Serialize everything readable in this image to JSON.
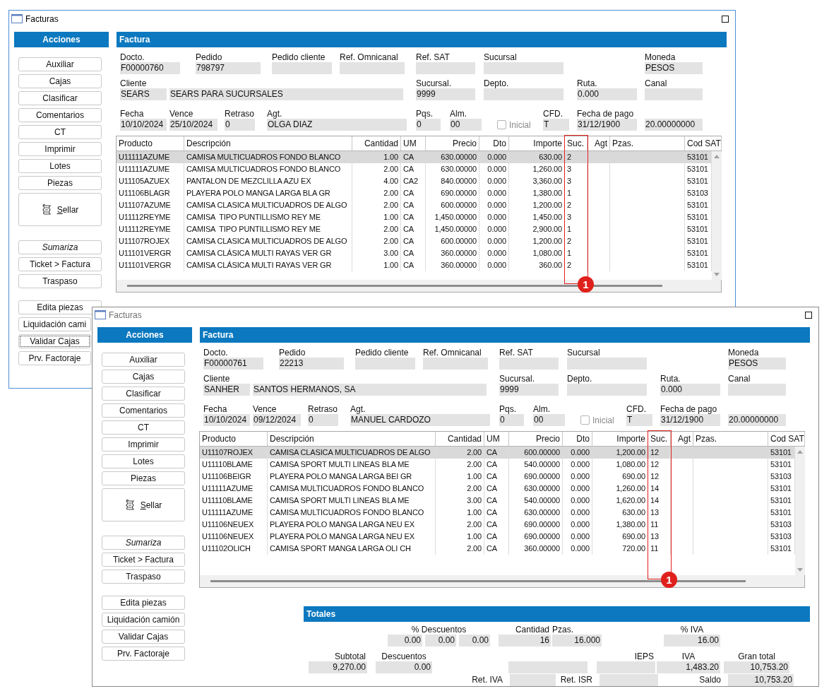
{
  "windows": [
    {
      "title": "Facturas",
      "active": true,
      "sidebar": {
        "title": "Acciones",
        "groups": [
          [
            {
              "kind": "plain",
              "label": "Auxiliar",
              "focused": false
            },
            {
              "kind": "plain",
              "label": "Cajas",
              "focused": false
            },
            {
              "kind": "plain",
              "label": "Clasificar",
              "focused": false
            },
            {
              "kind": "plain",
              "label": "Comentarios",
              "focused": false
            },
            {
              "kind": "plain",
              "label": "CT",
              "focused": false
            },
            {
              "kind": "plain",
              "label": "Imprimir",
              "focused": false
            },
            {
              "kind": "plain",
              "label": "Lotes",
              "focused": false
            },
            {
              "kind": "plain",
              "label": "Piezas",
              "focused": false
            },
            {
              "kind": "icon",
              "label": "Sellar",
              "focused": false
            }
          ],
          [
            {
              "kind": "mode",
              "label": "Sumariza",
              "focused": false
            },
            {
              "kind": "plain",
              "label": "Ticket > Factura",
              "focused": false
            },
            {
              "kind": "plain",
              "label": "Traspaso",
              "focused": false
            }
          ],
          [
            {
              "kind": "plain",
              "label": "Edita piezas",
              "focused": false
            },
            {
              "kind": "clipped",
              "label": "Liquidación cami",
              "focused": false
            },
            {
              "kind": "clipped",
              "label": "Validar Cajas",
              "focused": true
            },
            {
              "kind": "clipped",
              "label": "Prv. Factoraje",
              "focused": false
            }
          ]
        ]
      },
      "panel_title": "Factura",
      "form": {
        "fields": [
          {
            "kind": "text",
            "label": "Docto.",
            "value": "F00000760"
          },
          {
            "kind": "text",
            "label": "Pedido",
            "value": "798797"
          },
          {
            "kind": "text",
            "label": "Pedido cliente"
          },
          {
            "kind": "text",
            "label": "Ref. Omnicanal"
          },
          {
            "kind": "text",
            "label": "Ref. SAT"
          },
          {
            "kind": "text",
            "label": "Sucursal"
          },
          {
            "kind": "text",
            "label": "Moneda",
            "value": "PESOS"
          },
          {
            "kind": "text",
            "label": "Cliente",
            "value": "SEARS"
          },
          {
            "kind": "text",
            "value": "SEARS PARA SUCURSALES"
          },
          {
            "kind": "text",
            "label": "Sucursal.",
            "value": "9999"
          },
          {
            "kind": "text",
            "label": "Depto."
          },
          {
            "kind": "text",
            "label": "Ruta.",
            "value": "0.000"
          },
          {
            "kind": "text",
            "label": "Canal"
          },
          {
            "kind": "text",
            "label": "Fecha",
            "value": "10/10/2024"
          },
          {
            "kind": "text",
            "label": "Vence",
            "value": "25/10/2024"
          },
          {
            "kind": "text",
            "label": "Retraso",
            "value": "0"
          },
          {
            "kind": "text",
            "label": "Agt.",
            "value": "OLGA DIAZ"
          },
          {
            "kind": "text",
            "label": "Pqs.",
            "value": "0"
          },
          {
            "kind": "text",
            "label": "Alm.",
            "value": "00"
          },
          {
            "kind": "checkbox",
            "label": "Inicial",
            "checked": false,
            "disabled": true
          },
          {
            "kind": "text",
            "label": "CFD.",
            "value": "T"
          },
          {
            "kind": "text",
            "label": "Fecha de pago",
            "value": "31/12/1900"
          },
          {
            "kind": "text",
            "value": "20.00000000"
          }
        ]
      },
      "table": {
        "columns": [
          "Producto",
          "Descripción",
          "Cantidad",
          "UM",
          "Precio",
          "Dto",
          "Importe",
          "Suc.",
          "Agt",
          "Pzas.",
          "Cod SAT"
        ],
        "annotation": {
          "badge": "1"
        },
        "rows": [
          {
            "selected": true,
            "producto": "U11111AZUME",
            "descripcion": "CAMISA MULTICUADROS FONDO BLANCO",
            "cantidad": "1.00",
            "um": "CA",
            "precio": "630.00000",
            "dto": "0.000",
            "importe": "630.00",
            "suc": "2",
            "cod_sat": "53101"
          },
          {
            "selected": false,
            "producto": "U11111AZUME",
            "descripcion": "CAMISA MULTICUADROS FONDO BLANCO",
            "cantidad": "2.00",
            "um": "CA",
            "precio": "630.00000",
            "dto": "0.000",
            "importe": "1,260.00",
            "suc": "3",
            "cod_sat": "53101"
          },
          {
            "selected": false,
            "producto": "U11105AZUEX",
            "descripcion": "PANTALON DE MEZCLILLA AZU EX",
            "cantidad": "4.00",
            "um": "CA2",
            "precio": "840.00000",
            "dto": "0.000",
            "importe": "3,360.00",
            "suc": "3",
            "cod_sat": "53101"
          },
          {
            "selected": false,
            "producto": "U11106BLAGR",
            "descripcion": "PLAYERA POLO MANGA LARGA BLA GR",
            "cantidad": "2.00",
            "um": "CA",
            "precio": "690.00000",
            "dto": "0.000",
            "importe": "1,380.00",
            "suc": "1",
            "cod_sat": "53103"
          },
          {
            "selected": false,
            "producto": "U11107AZUME",
            "descripcion": "CAMISA CLASICA MULTICUADROS DE ALGO",
            "cantidad": "2.00",
            "um": "CA",
            "precio": "600.00000",
            "dto": "0.000",
            "importe": "1,200.00",
            "suc": "2",
            "cod_sat": "53101"
          },
          {
            "selected": false,
            "producto": "U11112REYME",
            "descripcion": "CAMISA  TIPO PUNTILLISMO REY ME",
            "cantidad": "1.00",
            "um": "CA",
            "precio": "1,450.00000",
            "dto": "0.000",
            "importe": "1,450.00",
            "suc": "3",
            "cod_sat": "53101"
          },
          {
            "selected": false,
            "producto": "U11112REYME",
            "descripcion": "CAMISA  TIPO PUNTILLISMO REY ME",
            "cantidad": "2.00",
            "um": "CA",
            "precio": "1,450.00000",
            "dto": "0.000",
            "importe": "2,900.00",
            "suc": "1",
            "cod_sat": "53101"
          },
          {
            "selected": false,
            "producto": "U11107ROJEX",
            "descripcion": "CAMISA CLASICA MULTICUADROS DE ALGO",
            "cantidad": "2.00",
            "um": "CA",
            "precio": "600.00000",
            "dto": "0.000",
            "importe": "1,200.00",
            "suc": "2",
            "cod_sat": "53101"
          },
          {
            "selected": false,
            "producto": "U11101VERGR",
            "descripcion": "CAMISA CLÁSICA MULTI RAYAS VER GR",
            "cantidad": "3.00",
            "um": "CA",
            "precio": "360.00000",
            "dto": "0.000",
            "importe": "1,080.00",
            "suc": "1",
            "cod_sat": "53101"
          },
          {
            "selected": false,
            "producto": "U11101VERGR",
            "descripcion": "CAMISA CLÁSICA MULTI RAYAS VER GR",
            "cantidad": "1.00",
            "um": "CA",
            "precio": "360.00000",
            "dto": "0.000",
            "importe": "360.00",
            "suc": "2",
            "cod_sat": "53101"
          }
        ]
      }
    },
    {
      "title": "Facturas",
      "active": false,
      "sidebar": {
        "title": "Acciones",
        "groups": [
          [
            {
              "kind": "plain",
              "label": "Auxiliar",
              "focused": false
            },
            {
              "kind": "plain",
              "label": "Cajas",
              "focused": false
            },
            {
              "kind": "plain",
              "label": "Clasificar",
              "focused": false
            },
            {
              "kind": "plain",
              "label": "Comentarios",
              "focused": false
            },
            {
              "kind": "plain",
              "label": "CT",
              "focused": false
            },
            {
              "kind": "plain",
              "label": "Imprimir",
              "focused": false
            },
            {
              "kind": "plain",
              "label": "Lotes",
              "focused": false
            },
            {
              "kind": "plain",
              "label": "Piezas",
              "focused": false
            },
            {
              "kind": "icon",
              "label": "Sellar",
              "focused": false
            }
          ],
          [
            {
              "kind": "mode",
              "label": "Sumariza",
              "focused": false
            },
            {
              "kind": "plain",
              "label": "Ticket > Factura",
              "focused": false
            },
            {
              "kind": "plain",
              "label": "Traspaso",
              "focused": false
            }
          ],
          [
            {
              "kind": "plain",
              "label": "Edita piezas",
              "focused": false
            },
            {
              "kind": "plain",
              "label": "Liquidación camión",
              "focused": false
            },
            {
              "kind": "plain",
              "label": "Validar Cajas",
              "focused": false
            },
            {
              "kind": "plain",
              "label": "Prv. Factoraje",
              "focused": false
            }
          ]
        ]
      },
      "panel_title": "Factura",
      "form": {
        "fields": [
          {
            "kind": "text",
            "label": "Docto.",
            "value": "F00000761"
          },
          {
            "kind": "text",
            "label": "Pedido",
            "value": "22213"
          },
          {
            "kind": "text",
            "label": "Pedido cliente"
          },
          {
            "kind": "text",
            "label": "Ref. Omnicanal"
          },
          {
            "kind": "text",
            "label": "Ref. SAT"
          },
          {
            "kind": "text",
            "label": "Sucursal"
          },
          {
            "kind": "text",
            "label": "Moneda",
            "value": "PESOS"
          },
          {
            "kind": "text",
            "label": "Cliente",
            "value": "SANHER"
          },
          {
            "kind": "text",
            "value": "SANTOS HERMANOS, SA"
          },
          {
            "kind": "text",
            "label": "Sucursal.",
            "value": "9999"
          },
          {
            "kind": "text",
            "label": "Depto."
          },
          {
            "kind": "text",
            "label": "Ruta.",
            "value": "0.000"
          },
          {
            "kind": "text",
            "label": "Canal"
          },
          {
            "kind": "text",
            "label": "Fecha",
            "value": "10/10/2024"
          },
          {
            "kind": "text",
            "label": "Vence",
            "value": "09/12/2024"
          },
          {
            "kind": "text",
            "label": "Retraso",
            "value": "0"
          },
          {
            "kind": "text",
            "label": "Agt.",
            "value": "MANUEL CARDOZO"
          },
          {
            "kind": "text",
            "label": "Pqs.",
            "value": "0"
          },
          {
            "kind": "text",
            "label": "Alm.",
            "value": "00"
          },
          {
            "kind": "checkbox",
            "label": "Inicial",
            "checked": false,
            "disabled": true
          },
          {
            "kind": "text",
            "label": "CFD.",
            "value": "T"
          },
          {
            "kind": "text",
            "label": "Fecha de pago",
            "value": "31/12/1900"
          },
          {
            "kind": "text",
            "value": "20.00000000"
          }
        ]
      },
      "table": {
        "columns": [
          "Producto",
          "Descripción",
          "Cantidad",
          "UM",
          "Precio",
          "Dto",
          "Importe",
          "Suc.",
          "Agt",
          "Pzas.",
          "Cod SAT"
        ],
        "annotation": {
          "badge": "1"
        },
        "rows": [
          {
            "selected": true,
            "producto": "U11107ROJEX",
            "descripcion": "CAMISA CLASICA MULTICUADROS DE ALGO",
            "cantidad": "2.00",
            "um": "CA",
            "precio": "600.00000",
            "dto": "0.000",
            "importe": "1,200.00",
            "suc": "12",
            "cod_sat": "53101"
          },
          {
            "selected": false,
            "producto": "U11110BLAME",
            "descripcion": "CAMISA SPORT MULTI LINEAS BLA ME",
            "cantidad": "2.00",
            "um": "CA",
            "precio": "540.00000",
            "dto": "0.000",
            "importe": "1,080.00",
            "suc": "12",
            "cod_sat": "53101"
          },
          {
            "selected": false,
            "producto": "U11106BEIGR",
            "descripcion": "PLAYERA POLO MANGA LARGA BEI GR",
            "cantidad": "1.00",
            "um": "CA",
            "precio": "690.00000",
            "dto": "0.000",
            "importe": "690.00",
            "suc": "12",
            "cod_sat": "53103"
          },
          {
            "selected": false,
            "producto": "U11111AZUME",
            "descripcion": "CAMISA MULTICUADROS FONDO BLANCO",
            "cantidad": "2.00",
            "um": "CA",
            "precio": "630.00000",
            "dto": "0.000",
            "importe": "1,260.00",
            "suc": "14",
            "cod_sat": "53101"
          },
          {
            "selected": false,
            "producto": "U11110BLAME",
            "descripcion": "CAMISA SPORT MULTI LINEAS BLA ME",
            "cantidad": "3.00",
            "um": "CA",
            "precio": "540.00000",
            "dto": "0.000",
            "importe": "1,620.00",
            "suc": "14",
            "cod_sat": "53101"
          },
          {
            "selected": false,
            "producto": "U11111AZUME",
            "descripcion": "CAMISA MULTICUADROS FONDO BLANCO",
            "cantidad": "1.00",
            "um": "CA",
            "precio": "630.00000",
            "dto": "0.000",
            "importe": "630.00",
            "suc": "13",
            "cod_sat": "53101"
          },
          {
            "selected": false,
            "producto": "U11106NEUEX",
            "descripcion": "PLAYERA POLO MANGA LARGA NEU EX",
            "cantidad": "2.00",
            "um": "CA",
            "precio": "690.00000",
            "dto": "0.000",
            "importe": "1,380.00",
            "suc": "11",
            "cod_sat": "53103"
          },
          {
            "selected": false,
            "producto": "U11106NEUEX",
            "descripcion": "PLAYERA POLO MANGA LARGA NEU EX",
            "cantidad": "1.00",
            "um": "CA",
            "precio": "690.00000",
            "dto": "0.000",
            "importe": "690.00",
            "suc": "13",
            "cod_sat": "53103"
          },
          {
            "selected": false,
            "producto": "U11102OLICH",
            "descripcion": "CAMISA SPORT MANGA LARGA OLI CH",
            "cantidad": "2.00",
            "um": "CA",
            "precio": "360.00000",
            "dto": "0.000",
            "importe": "720.00",
            "suc": "11",
            "cod_sat": "53101"
          }
        ]
      },
      "totals": {
        "title": "Totales",
        "fields": [
          {
            "kind": "stacked",
            "label": "% Descuentos",
            "values": [
              "0.00",
              "0.00",
              "0.00"
            ]
          },
          {
            "kind": "stacked",
            "label": "Cantidad",
            "values": [
              "16"
            ]
          },
          {
            "kind": "stacked",
            "label": "Pzas.",
            "values": [
              "16.000"
            ]
          },
          {
            "kind": "stacked",
            "label": "% IVA",
            "values": [
              "16.00"
            ]
          },
          {
            "kind": "stacked",
            "label": "Subtotal",
            "values": [
              "9,270.00"
            ]
          },
          {
            "kind": "stacked",
            "label": "Descuentos",
            "values": [
              "0.00"
            ]
          },
          {
            "kind": "stacked"
          },
          {
            "kind": "stacked",
            "label": "IEPS"
          },
          {
            "kind": "stacked",
            "label": "IVA",
            "values": [
              "1,483.20"
            ]
          },
          {
            "kind": "stacked",
            "label": "Gran total",
            "values": [
              "10,753.20"
            ]
          },
          {
            "kind": "inline",
            "label": "Ret. IVA"
          },
          {
            "kind": "inline",
            "label": "Ret. ISR"
          },
          {
            "kind": "inline",
            "label": "Saldo",
            "values": [
              "10,753.20"
            ]
          }
        ]
      }
    }
  ]
}
